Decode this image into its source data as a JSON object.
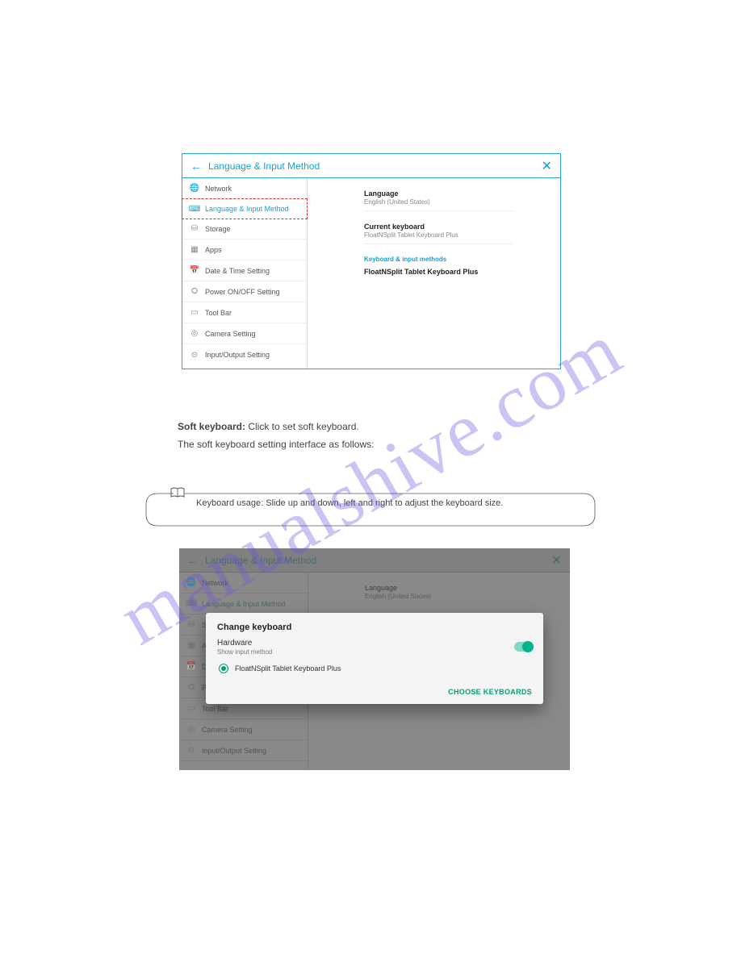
{
  "watermark": "manualshive.com",
  "win1": {
    "title": "Language & Input Method",
    "sidebar": [
      {
        "label": "Network",
        "icon": "globe"
      },
      {
        "label": "Language & Input Method",
        "icon": "keyboard",
        "active": true
      },
      {
        "label": "Storage",
        "icon": "storage"
      },
      {
        "label": "Apps",
        "icon": "apps"
      },
      {
        "label": "Date & Time Setting",
        "icon": "calendar"
      },
      {
        "label": "Power ON/OFF Setting",
        "icon": "power"
      },
      {
        "label": "Tool Bar",
        "icon": "toolbar"
      },
      {
        "label": "Camera Setting",
        "icon": "camera"
      },
      {
        "label": "Input/Output Setting",
        "icon": "io"
      }
    ],
    "content": {
      "language_h": "Language",
      "language_s": "English (United States)",
      "keyboard_h": "Current keyboard",
      "keyboard_s": "FloatNSplit Tablet Keyboard Plus",
      "section": "Keyboard & input methods",
      "method": "FloatNSplit Tablet Keyboard Plus"
    }
  },
  "caption": {
    "bold": "Soft keyboard:",
    "rest": " Click to set soft keyboard.",
    "second": "The soft keyboard setting interface as follows:"
  },
  "note": "Keyboard usage: Slide up and down, left and right to adjust the keyboard size.",
  "win2": {
    "title": "Language & Input Method",
    "sidebar": [
      {
        "label": "Network"
      },
      {
        "label": "Language & Input Method",
        "active": true
      },
      {
        "label": "Storage"
      },
      {
        "label": "Apps"
      },
      {
        "label": "Date & Time Setting"
      },
      {
        "label": "Power ON/OFF Setting"
      },
      {
        "label": "Tool Bar"
      },
      {
        "label": "Camera Setting"
      },
      {
        "label": "Input/Output Setting"
      }
    ],
    "content": {
      "language_h": "Language",
      "language_s": "English (United States)"
    },
    "dialog": {
      "title": "Change keyboard",
      "hardware": "Hardware",
      "hardware_sub": "Show input method",
      "option": "FloatNSplit Tablet Keyboard Plus",
      "action": "CHOOSE KEYBOARDS"
    }
  },
  "icons": {
    "globe": "🌐",
    "keyboard": "⌨",
    "storage": "⛁",
    "apps": "▦",
    "calendar": "📅",
    "power": "⭘",
    "toolbar": "▭",
    "camera": "◎",
    "io": "⊝"
  }
}
